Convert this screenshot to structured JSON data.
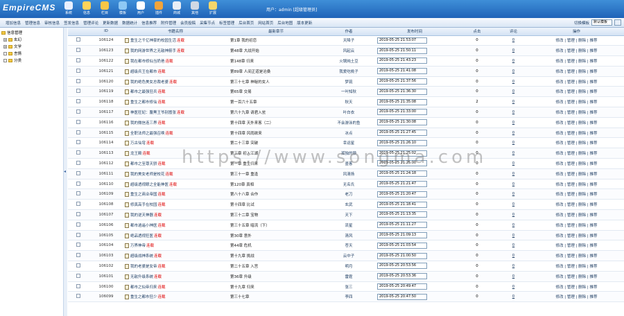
{
  "app": {
    "logo": "EmpireCMS",
    "nav": [
      {
        "label": "系统",
        "icon": "system-icon",
        "color": "#e8f0ff"
      },
      {
        "label": "信息",
        "icon": "edit-icon",
        "color": "#ffd45a"
      },
      {
        "label": "栏目",
        "icon": "folder-icon",
        "color": "#f6c646"
      },
      {
        "label": "模板",
        "icon": "template-icon",
        "color": "#8ec8f4"
      },
      {
        "label": "用户",
        "icon": "user-icon",
        "color": "#ffffff"
      },
      {
        "label": "插件",
        "icon": "plugin-icon",
        "color": "#f2a43a"
      },
      {
        "label": "商城",
        "icon": "shop-icon",
        "color": "#e9eef6"
      },
      {
        "label": "其他",
        "icon": "other-icon",
        "color": "#d0d8e4"
      },
      {
        "label": "扩展",
        "icon": "extend-icon",
        "color": "#f5d66a"
      }
    ],
    "user_info": "用户：admin [超级管理员]"
  },
  "submenu": [
    "增加信息",
    "管理信息",
    "审核信息",
    "签发信息",
    "管理评论",
    "更新数据",
    "数据统计",
    "信息推荐",
    "附件管理",
    "会员投稿",
    "采集节点",
    "标签管理",
    "后台首页",
    "网站首页",
    "后台地图",
    "版本更新"
  ],
  "subright": {
    "label": "切换模板",
    "select": "默认模板"
  },
  "tree": {
    "root": "信息管理",
    "nodes": [
      {
        "label": "玄幻",
        "toggle": "+"
      },
      {
        "label": "文学",
        "toggle": "+"
      },
      {
        "label": "言情",
        "toggle": ""
      },
      {
        "label": "分类",
        "toggle": ""
      }
    ]
  },
  "table": {
    "headers": [
      "",
      "ID",
      "书籍名称",
      "最新章节",
      "作者",
      "发布时间",
      "点击",
      "评论",
      "操作"
    ],
    "ops": "修改 | 管理 | 删除 | 推荐",
    "rows": [
      {
        "id": "106124",
        "title": "重生之千亿神豪的校园生活",
        "tag": "连载",
        "chapter": "第1章 我的初恋",
        "author": "天降子",
        "time": "2019-05-25 21:53:07",
        "click": "0",
        "comment": "0"
      },
      {
        "id": "106123",
        "title": "我的网游世界之无敌神箭手",
        "tag": "连载",
        "chapter": "第48章 大战开始",
        "author": "风起云",
        "time": "2019-05-25 21:50:11",
        "click": "0",
        "comment": "0"
      },
      {
        "id": "106122",
        "title": "我在都市修仙当奶爸",
        "tag": "连载",
        "chapter": "第148章 归来",
        "author": "火锅炖土豆",
        "time": "2019-05-25 21:43:23",
        "click": "0",
        "comment": "0"
      },
      {
        "id": "106121",
        "title": "超级兵王在都市",
        "tag": "连载",
        "chapter": "第89章 人间正道是沧桑",
        "author": "我爱吃桃子",
        "time": "2019-05-25 21:41:08",
        "click": "0",
        "comment": "0"
      },
      {
        "id": "106120",
        "title": "我的绝色美女总裁老婆",
        "tag": "连载",
        "chapter": "第三十七章 神秘的女人",
        "author": "梦琉",
        "time": "2019-05-25 21:37:56",
        "click": "0",
        "comment": "0"
      },
      {
        "id": "106119",
        "title": "都市之最强狂兵",
        "tag": "连载",
        "chapter": "第65章 交易",
        "author": "一叶知秋",
        "time": "2019-05-25 21:36:30",
        "click": "0",
        "comment": "0"
      },
      {
        "id": "106118",
        "title": "重生之都市修仙",
        "tag": "连载",
        "chapter": "第一百六十五章",
        "author": "秋天",
        "time": "2019-05-25 21:35:08",
        "click": "2",
        "comment": "0"
      },
      {
        "id": "106117",
        "title": "神医狂妃：腹黑王爷别嚣张",
        "tag": "连载",
        "chapter": "第六十九章 请君入瓮",
        "author": "叶白衣",
        "time": "2019-05-25 21:33:00",
        "click": "0",
        "comment": "0"
      },
      {
        "id": "106116",
        "title": "我的微信连三界",
        "tag": "连载",
        "chapter": "第十四章 天外来客（二）",
        "author": "不会游泳的鱼",
        "time": "2019-05-25 21:30:08",
        "click": "0",
        "comment": "0"
      },
      {
        "id": "106115",
        "title": "全职法师之最强召唤",
        "tag": "连载",
        "chapter": "第十四章 风雨欲来",
        "author": "冰点",
        "time": "2019-05-25 21:27:45",
        "click": "0",
        "comment": "0"
      },
      {
        "id": "106114",
        "title": "万古仙穹",
        "tag": "连载",
        "chapter": "第二十三章 突破",
        "author": "幸运星",
        "time": "2019-05-25 21:26:10",
        "click": "0",
        "comment": "0"
      },
      {
        "id": "106113",
        "title": "龙王殿",
        "tag": "连载",
        "chapter": "第三章 初入江湖",
        "author": "孤独的狼",
        "time": "2019-05-25 21:25:02",
        "click": "0",
        "comment": "0"
      },
      {
        "id": "106112",
        "title": "都市之至尊天骄",
        "tag": "连载",
        "chapter": "第一章 重生归来",
        "author": "墨客",
        "time": "2019-05-25 21:25:00",
        "click": "0",
        "comment": "0"
      },
      {
        "id": "106111",
        "title": "我的美女老师是校花",
        "tag": "连载",
        "chapter": "第三十一章 重逢",
        "author": "风清扬",
        "time": "2019-05-25 21:24:18",
        "click": "0",
        "comment": "0"
      },
      {
        "id": "106110",
        "title": "超级透视眼之全能神医",
        "tag": "连载",
        "chapter": "第120章 真相",
        "author": "无名氏",
        "time": "2019-05-25 21:21:47",
        "click": "0",
        "comment": "0"
      },
      {
        "id": "106109",
        "title": "重生之商业帝国",
        "tag": "连载",
        "chapter": "第八十八章 合作",
        "author": "老刀",
        "time": "2019-05-25 21:20:47",
        "click": "0",
        "comment": "0"
      },
      {
        "id": "106108",
        "title": "修真高手在校园",
        "tag": "连载",
        "chapter": "第十四章 比试",
        "author": "玄武",
        "time": "2019-05-25 21:18:41",
        "click": "0",
        "comment": "0"
      },
      {
        "id": "106107",
        "title": "我的逆天神器",
        "tag": "连载",
        "chapter": "第三十二章 宝物",
        "author": "天下",
        "time": "2019-05-25 21:13:35",
        "click": "0",
        "comment": "0"
      },
      {
        "id": "106106",
        "title": "都市逍遥小神医",
        "tag": "连载",
        "chapter": "第三十五章 暗流（下）",
        "author": "流星",
        "time": "2019-05-25 21:11:27",
        "click": "0",
        "comment": "0"
      },
      {
        "id": "106105",
        "title": "绝品透视狂医",
        "tag": "连载",
        "chapter": "第30章 意外",
        "author": "清风",
        "time": "2019-05-25 21:09:13",
        "click": "0",
        "comment": "0"
      },
      {
        "id": "106104",
        "title": "万界神帝",
        "tag": "连载",
        "chapter": "第44章 危机",
        "author": "苍天",
        "time": "2019-05-25 21:03:54",
        "click": "0",
        "comment": "0"
      },
      {
        "id": "106103",
        "title": "超级战神系统",
        "tag": "连载",
        "chapter": "第十九章 挑战",
        "author": "云中子",
        "time": "2019-05-25 21:00:50",
        "click": "0",
        "comment": "0"
      },
      {
        "id": "106102",
        "title": "我的老婆是女帝",
        "tag": "连载",
        "chapter": "第二十五章 入宫",
        "author": "明月",
        "time": "2019-05-25 20:53:56",
        "click": "0",
        "comment": "0"
      },
      {
        "id": "106101",
        "title": "无敌升级系统",
        "tag": "连载",
        "chapter": "第36章 升级",
        "author": "雷霆",
        "time": "2019-05-25 20:53:36",
        "click": "0",
        "comment": "0"
      },
      {
        "id": "106100",
        "title": "都市之仙帝归来",
        "tag": "连载",
        "chapter": "第十九章 归来",
        "author": "张三",
        "time": "2019-05-25 20:49:47",
        "click": "0",
        "comment": "0"
      },
      {
        "id": "106099",
        "title": "重生之都市狂少",
        "tag": "连载",
        "chapter": "第三十七章",
        "author": "李四",
        "time": "2019-05-25 20:47:50",
        "click": "0",
        "comment": "0"
      }
    ]
  },
  "watermark": "https://www.songma.com"
}
